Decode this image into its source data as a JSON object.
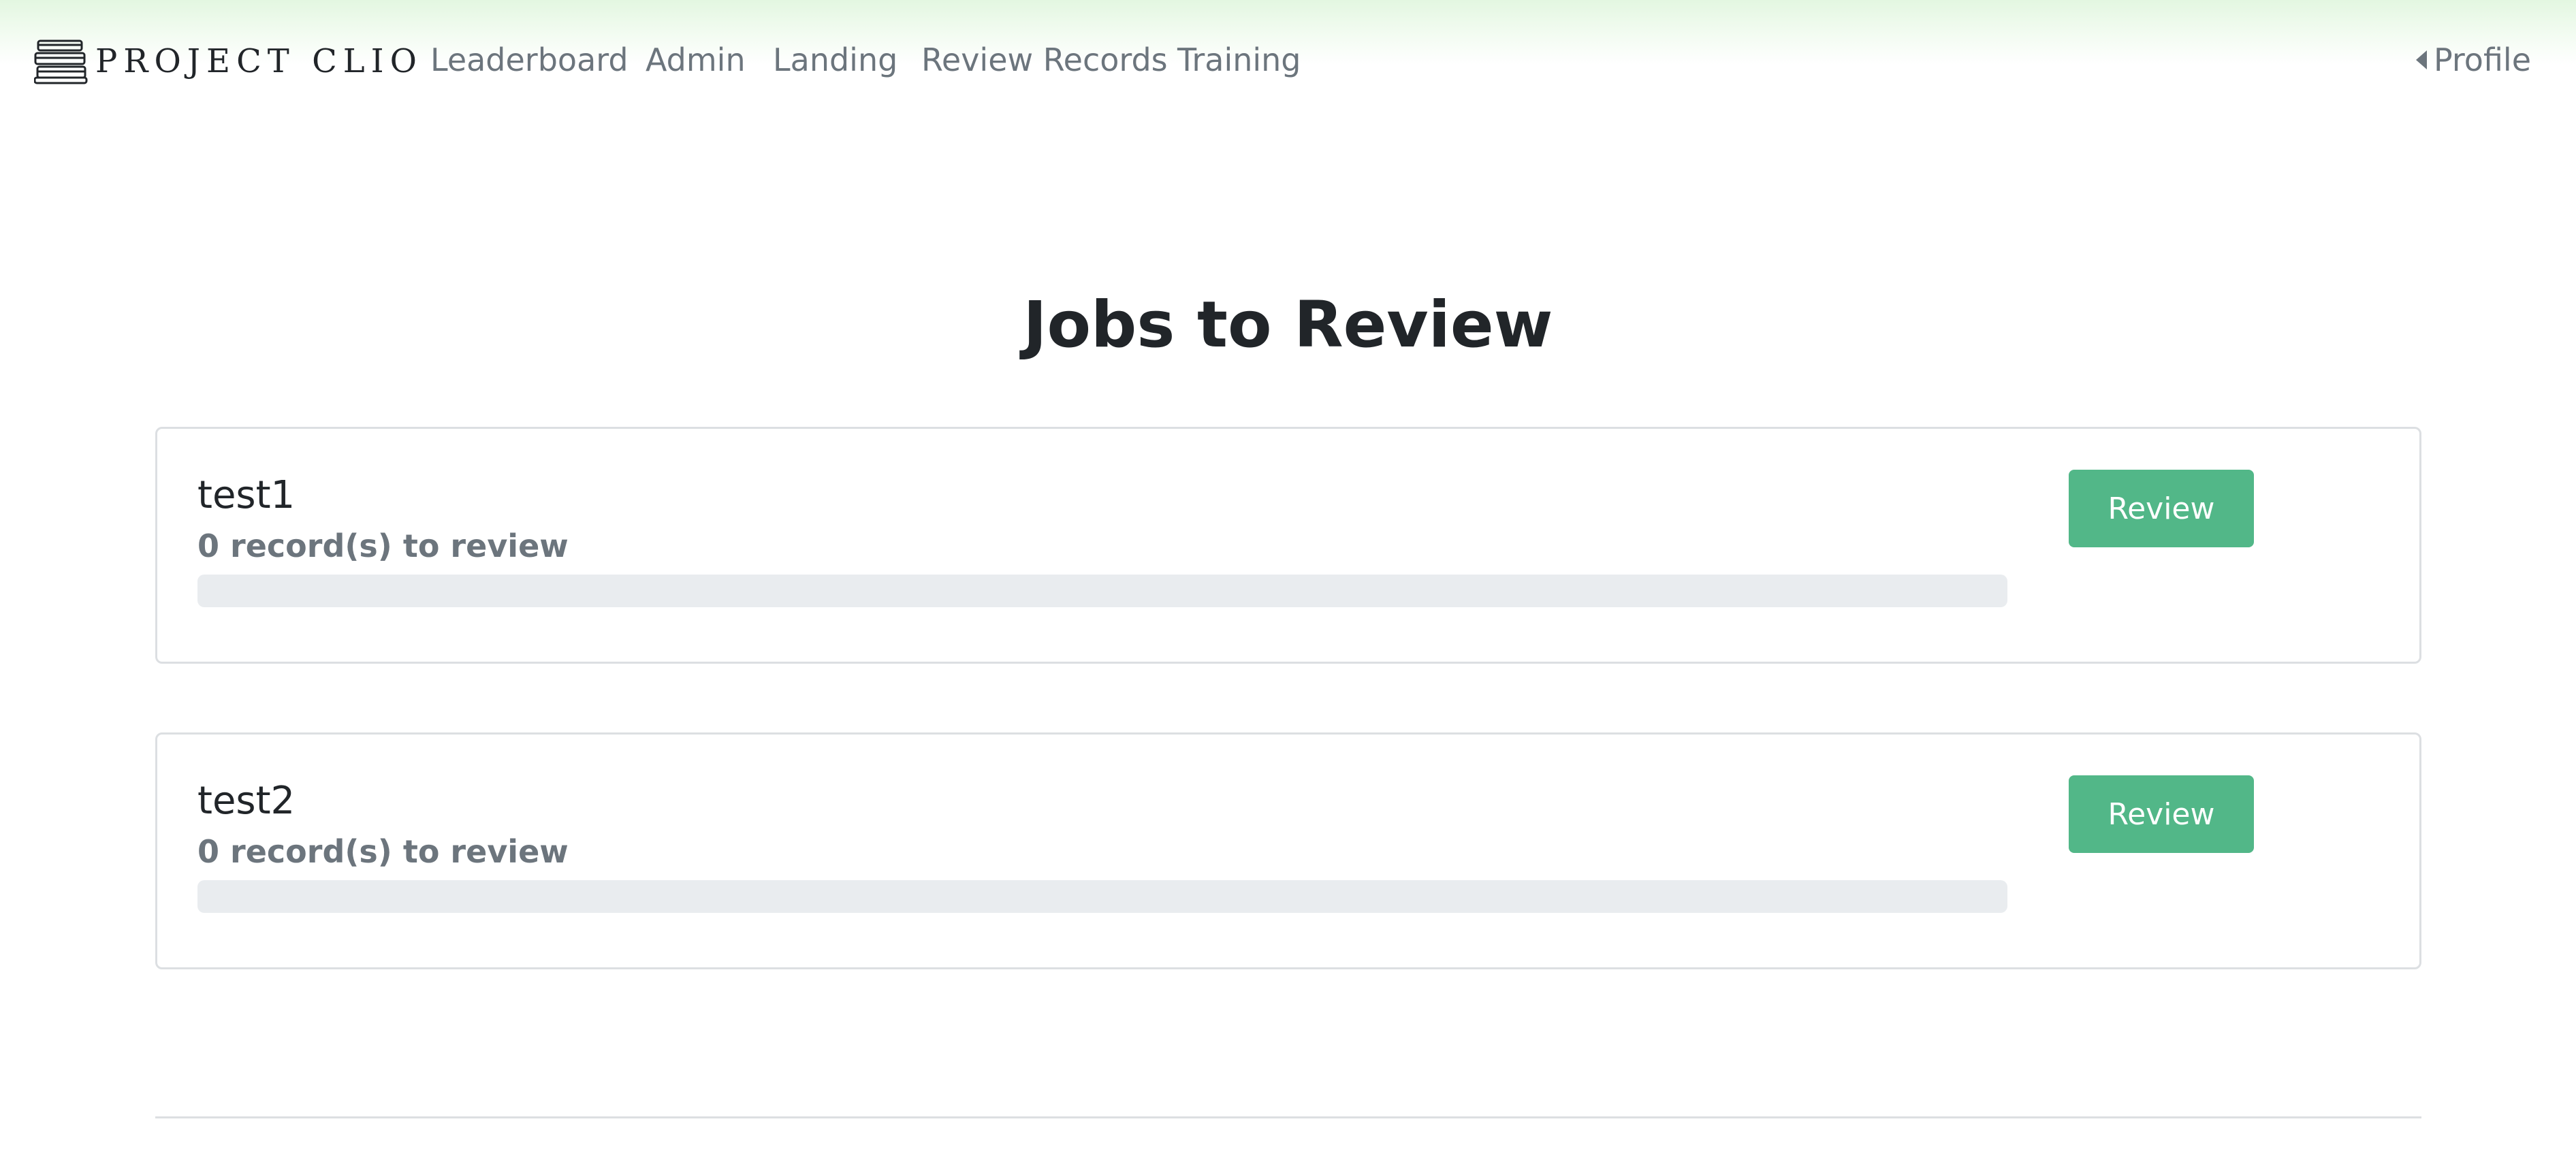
{
  "brand": {
    "name": "PROJECT CLIO",
    "icon": "book-stack-icon"
  },
  "nav": {
    "items": [
      {
        "label": "Leaderboard"
      },
      {
        "label": "Admin"
      },
      {
        "label": "Landing"
      },
      {
        "label": "Review Records"
      },
      {
        "label": "Training"
      }
    ],
    "profile_label": "Profile",
    "profile_icon": "caret-left-icon"
  },
  "main": {
    "title": "Jobs to Review",
    "jobs": [
      {
        "name": "test1",
        "subtitle": "0 record(s) to review",
        "progress_percent": 0,
        "button_label": "Review"
      },
      {
        "name": "test2",
        "subtitle": "0 record(s) to review",
        "progress_percent": 0,
        "button_label": "Review"
      }
    ]
  },
  "colors": {
    "accent": "#52b788",
    "nav_text": "#6c757d",
    "progress_track": "#e9ecef"
  }
}
